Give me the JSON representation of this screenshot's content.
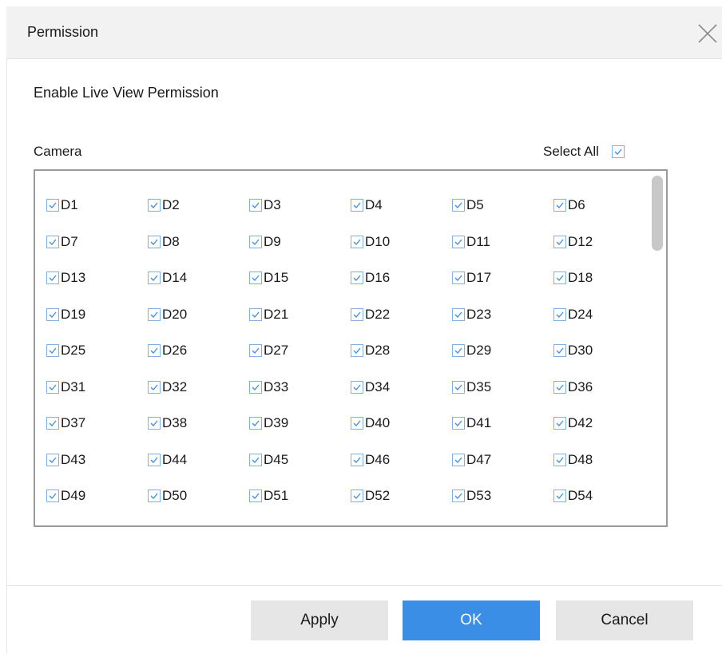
{
  "dialog": {
    "title": "Permission",
    "section_title": "Enable Live View Permission",
    "camera_label": "Camera",
    "select_all": {
      "label": "Select All",
      "checked": true
    },
    "cameras": [
      "D1",
      "D2",
      "D3",
      "D4",
      "D5",
      "D6",
      "D7",
      "D8",
      "D9",
      "D10",
      "D11",
      "D12",
      "D13",
      "D14",
      "D15",
      "D16",
      "D17",
      "D18",
      "D19",
      "D20",
      "D21",
      "D22",
      "D23",
      "D24",
      "D25",
      "D26",
      "D27",
      "D28",
      "D29",
      "D30",
      "D31",
      "D32",
      "D33",
      "D34",
      "D35",
      "D36",
      "D37",
      "D38",
      "D39",
      "D40",
      "D41",
      "D42",
      "D43",
      "D44",
      "D45",
      "D46",
      "D47",
      "D48",
      "D49",
      "D50",
      "D51",
      "D52",
      "D53",
      "D54"
    ],
    "buttons": {
      "apply": "Apply",
      "ok": "OK",
      "cancel": "Cancel"
    }
  },
  "colors": {
    "accent": "#3a8ee6",
    "checkbox_border": "#7fb0e6",
    "header_bg": "#f2f2f2",
    "button_gray": "#e6e6e6"
  },
  "icons": {
    "close": "close-icon",
    "check": "check-icon"
  }
}
